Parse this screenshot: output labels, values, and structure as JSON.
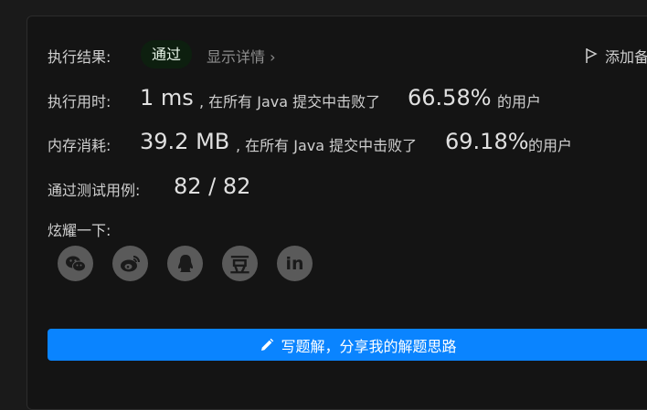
{
  "result": {
    "label": "执行结果:",
    "status": "通过",
    "details_link": "显示详情",
    "details_chevron": "›",
    "add_note": "添加备注"
  },
  "runtime": {
    "label": "执行用时:",
    "value": "1 ms",
    "middle": ", 在所有 Java 提交中击败了",
    "percent": "66.58%",
    "suffix": "的用户"
  },
  "memory": {
    "label": "内存消耗:",
    "value": "39.2 MB",
    "middle": ", 在所有 Java 提交中击败了",
    "percent": "69.18%",
    "suffix": "的用户"
  },
  "testcases": {
    "label": "通过测试用例:",
    "value": "82 / 82"
  },
  "share": {
    "label": "炫耀一下:",
    "icons": [
      "wechat-icon",
      "weibo-icon",
      "qq-icon",
      "douban-icon",
      "linkedin-icon"
    ],
    "douban_glyph": "豆",
    "linkedin_glyph": "in"
  },
  "solution_button": {
    "label": "写题解，分享我的解题思路"
  },
  "colors": {
    "accent": "#0a84ff",
    "badge_bg": "#0d1f0f",
    "icon_bg": "#5a5a5a"
  }
}
